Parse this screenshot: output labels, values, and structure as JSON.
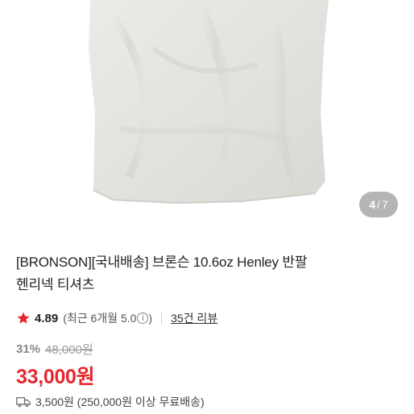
{
  "gallery": {
    "current": "4",
    "separator": "/",
    "total": "7"
  },
  "product": {
    "title_line1": "[BRONSON][국내배송] 브론슨 10.6oz Henley 반팔",
    "title_line2": "헨리넥 티셔츠"
  },
  "rating": {
    "score": "4.89",
    "recent_label": "(최근 6개월 5.0",
    "recent_close": ")",
    "review_link": "35건 리뷰",
    "star_color": "#e5262d"
  },
  "pricing": {
    "discount_rate": "31%",
    "original_price": "48,000원",
    "sale_price": "33,000원",
    "price_color": "#e5262d"
  },
  "shipping": {
    "text": "3,500원 (250,000원 이상 무료배송)"
  },
  "icons": [
    "star-icon",
    "info-icon",
    "truck-icon"
  ]
}
